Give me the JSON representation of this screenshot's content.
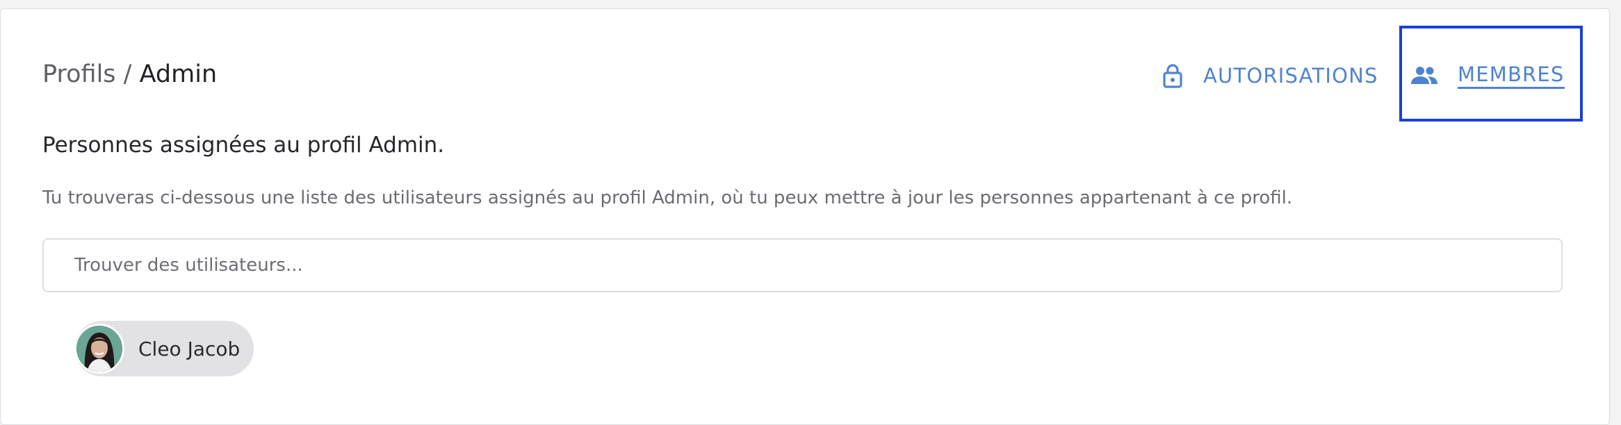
{
  "breadcrumb": {
    "parent": "Profils",
    "separator": " / ",
    "current": "Admin"
  },
  "tabs": [
    {
      "label": "AUTORISATIONS",
      "icon": "lock-icon",
      "active": false
    },
    {
      "label": "MEMBRES",
      "icon": "people-icon",
      "active": true
    }
  ],
  "section": {
    "title": "Personnes assignées au profil Admin.",
    "description": "Tu trouveras ci-dessous une liste des utilisateurs assignés au profil Admin, où tu peux mettre à jour les personnes appartenant à ce profil."
  },
  "search": {
    "placeholder": "Trouver des utilisateurs...",
    "value": ""
  },
  "members": [
    {
      "name": "Cleo Jacob",
      "avatar": "avatar-photo"
    }
  ],
  "colors": {
    "accent": "#4f83d0",
    "highlight": "#1a3fd8",
    "chip_bg": "#e2e2e4"
  }
}
